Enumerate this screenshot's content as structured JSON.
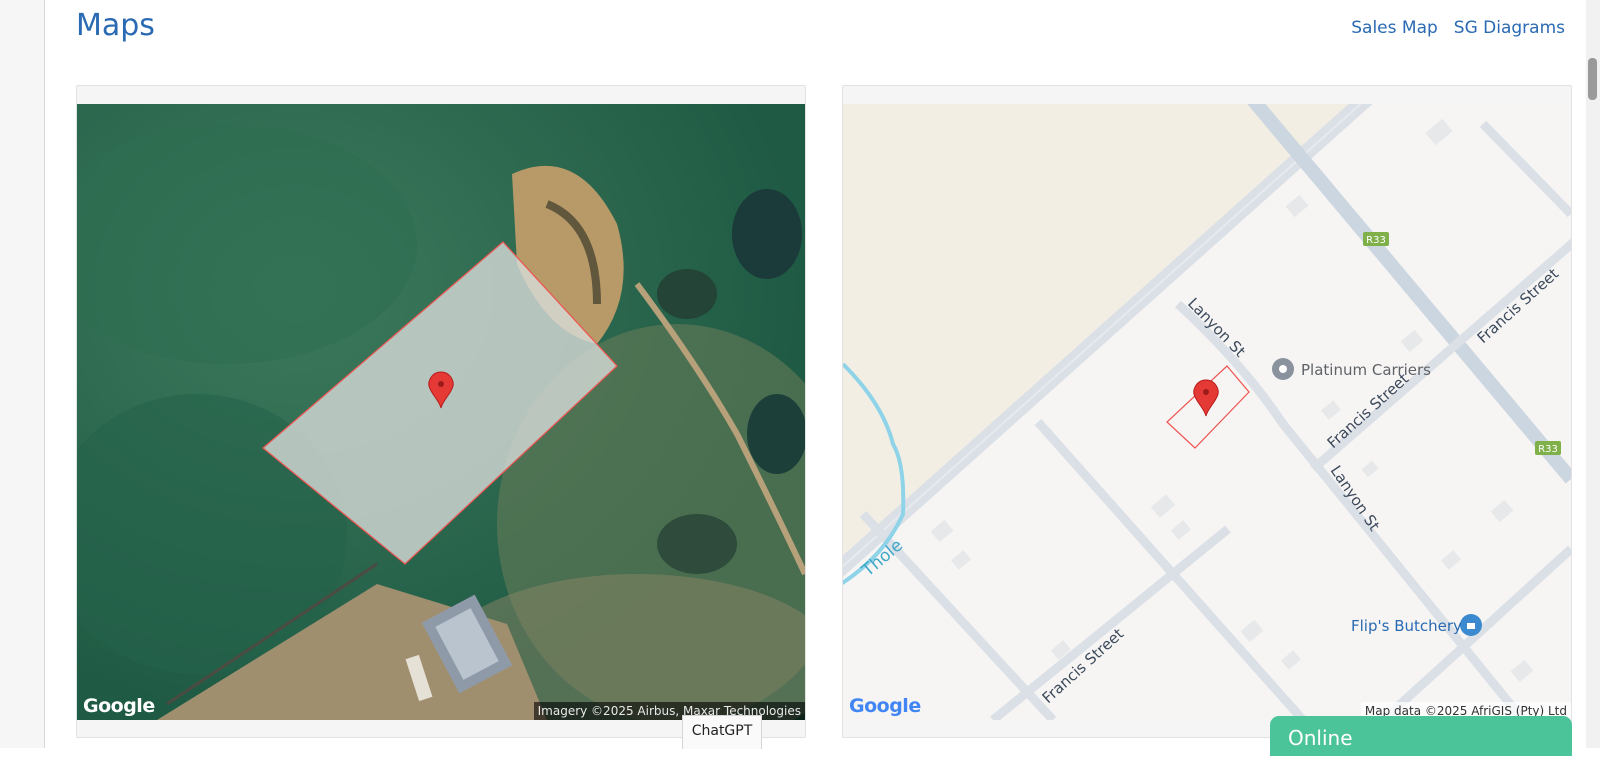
{
  "page": {
    "title": "Maps",
    "links": [
      "Sales Map",
      "SG Diagrams"
    ]
  },
  "satellite_map": {
    "google_logo": "Google",
    "attribution": "Imagery ©2025 Airbus, Maxar Technologies"
  },
  "road_map": {
    "google_logo": "Google",
    "attribution": "Map data ©2025 AfriGIS (Pty) Ltd",
    "labels": {
      "lanyon_st": "Lanyon St",
      "francis_street": "Francis Street",
      "thole": "Thole",
      "r33": "R33",
      "platinum_carriers": "Platinum Carriers",
      "flips_butchery": "Flip's Butchery"
    }
  },
  "tooltip": "ChatGPT",
  "chat_widget": {
    "status": "Online"
  },
  "colors": {
    "link": "#2a6ab3",
    "marker": "#e53935",
    "parcel_outline": "#ef5350",
    "online": "#4cc49a"
  }
}
